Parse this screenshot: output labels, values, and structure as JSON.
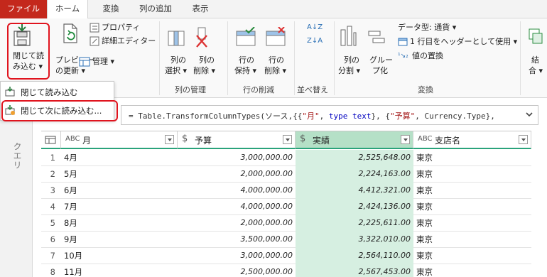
{
  "tabs": [
    "ファイル",
    "ホーム",
    "変換",
    "列の追加",
    "表示"
  ],
  "ribbon": {
    "close_load": [
      "閉じて読",
      "み込む ▾"
    ],
    "preview": [
      "プレビュー",
      "の更新 ▾"
    ],
    "properties": "プロパティ",
    "advanced_editor": "詳細エディター",
    "manage": "管理 ▾",
    "choose_columns": [
      "列の",
      "選択 ▾"
    ],
    "remove_columns": [
      "列の",
      "削除 ▾"
    ],
    "keep_rows": [
      "行の",
      "保持 ▾"
    ],
    "remove_rows": [
      "行の",
      "削除 ▾"
    ],
    "sort_asc": "A↓Z",
    "sort_desc": "Z↓A",
    "split_column": [
      "列の",
      "分割 ▾"
    ],
    "group_by": [
      "グルー",
      "プ化"
    ],
    "data_type": "データ型: 通貨 ▾",
    "use_first_row": "1 行目をヘッダーとして使用 ▾",
    "replace_values": "値の置換",
    "combine": [
      "結",
      "合 ▾"
    ],
    "groups": {
      "manage_columns": "列の管理",
      "reduce_rows": "行の削減",
      "sort": "並べ替え",
      "transform": "変換"
    }
  },
  "menu": {
    "close_load": "閉じて読み込む",
    "close_load_to": "閉じて次に読み込む..."
  },
  "side_label": "クエリ",
  "formula": {
    "prefix": "= Table.TransformColumnTypes(ソース,{{",
    "s1": "\"月\"",
    "mid1": ", ",
    "kw1": "type text",
    "mid2": "}, {",
    "s2": "\"予算\"",
    "mid3": ", Currency.Type},"
  },
  "columns": [
    {
      "type": "ABC",
      "name": "月"
    },
    {
      "type": "$",
      "name": "予算"
    },
    {
      "type": "$",
      "name": "実績"
    },
    {
      "type": "ABC",
      "name": "支店名"
    }
  ],
  "rows": [
    {
      "idx": "1",
      "month": "4月",
      "budget": "3,000,000.00",
      "actual": "2,525,648.00",
      "branch": "東京"
    },
    {
      "idx": "2",
      "month": "5月",
      "budget": "2,000,000.00",
      "actual": "2,224,163.00",
      "branch": "東京"
    },
    {
      "idx": "3",
      "month": "6月",
      "budget": "4,000,000.00",
      "actual": "4,412,321.00",
      "branch": "東京"
    },
    {
      "idx": "4",
      "month": "7月",
      "budget": "4,000,000.00",
      "actual": "2,424,136.00",
      "branch": "東京"
    },
    {
      "idx": "5",
      "month": "8月",
      "budget": "2,000,000.00",
      "actual": "2,225,611.00",
      "branch": "東京"
    },
    {
      "idx": "6",
      "month": "9月",
      "budget": "3,500,000.00",
      "actual": "3,322,010.00",
      "branch": "東京"
    },
    {
      "idx": "7",
      "month": "10月",
      "budget": "3,000,000.00",
      "actual": "2,564,110.00",
      "branch": "東京"
    },
    {
      "idx": "8",
      "month": "11月",
      "budget": "2,500,000.00",
      "actual": "2,567,453.00",
      "branch": "東京"
    }
  ],
  "colors": {
    "accent": "#c4281c",
    "highlight": "#e0141e",
    "selected_col": "#b5e0c7"
  }
}
